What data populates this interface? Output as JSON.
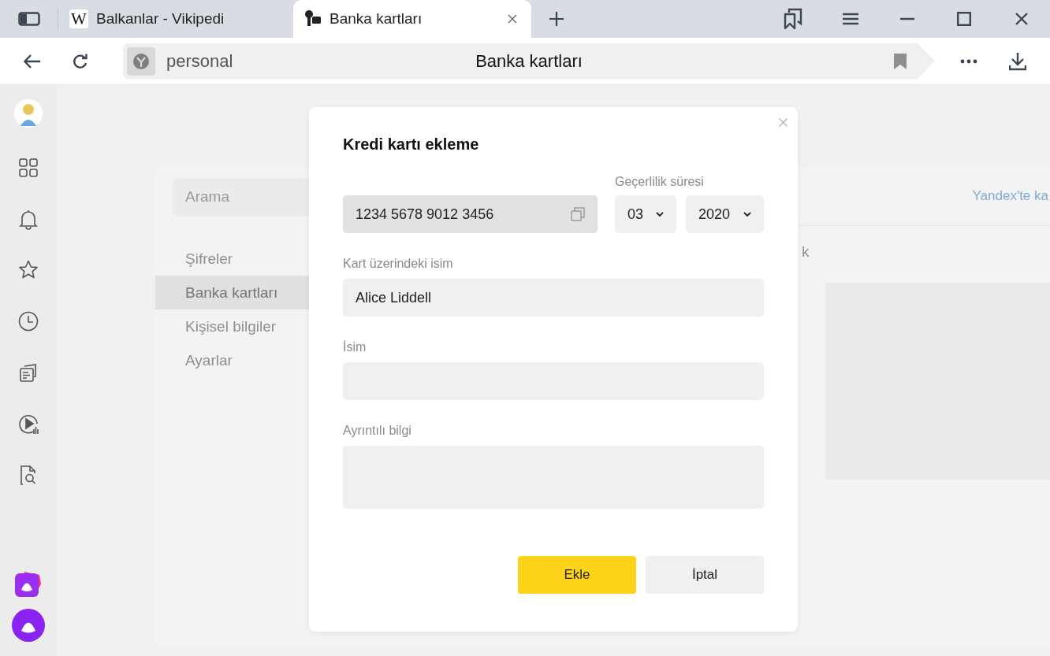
{
  "tabs": [
    {
      "title": "Balkanlar - Vikipedi",
      "kind": "wiki",
      "icon_text": "W",
      "selected": false
    },
    {
      "title": "Banka kartları",
      "kind": "cards",
      "selected": true
    }
  ],
  "address_bar": {
    "site": "personal",
    "page_title": "Banka kartları"
  },
  "settings_nav": {
    "search_placeholder": "Arama",
    "items": [
      {
        "label": "Şifreler",
        "selected": false
      },
      {
        "label": "Banka kartları",
        "selected": true
      },
      {
        "label": "Kişisel bilgiler",
        "selected": false
      },
      {
        "label": "Ayarlar",
        "selected": false
      }
    ]
  },
  "content": {
    "link": "Yandex'te ka",
    "partial_text": "k"
  },
  "dialog": {
    "title": "Kredi kartı ekleme",
    "card_number": "1234 5678 9012 3456",
    "expiry_label": "Geçerlilik süresi",
    "month": "03",
    "year": "2020",
    "fields": [
      {
        "label": "Kart üzerindeki isim",
        "value": "Alice Liddell",
        "kind": "line"
      },
      {
        "label": "İsim",
        "kind": "line"
      },
      {
        "label": "Ayrıntılı bilgi",
        "kind": "area"
      }
    ],
    "buttons": [
      {
        "label": "Ekle",
        "kind": "primary"
      },
      {
        "label": "İptal",
        "kind": "secondary"
      }
    ]
  }
}
